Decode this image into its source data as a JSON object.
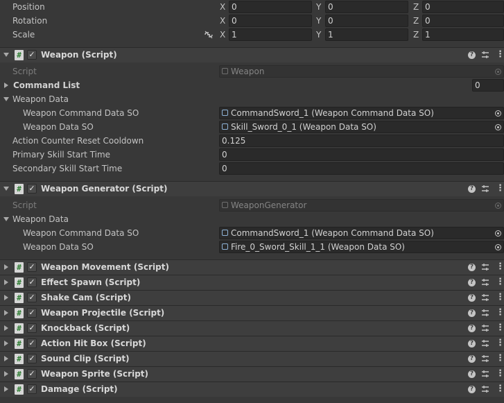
{
  "transform": {
    "position": {
      "label": "Position",
      "x": "0",
      "y": "0",
      "z": "0"
    },
    "rotation": {
      "label": "Rotation",
      "x": "0",
      "y": "0",
      "z": "0"
    },
    "scale": {
      "label": "Scale",
      "x": "1",
      "y": "1",
      "z": "1"
    },
    "axis_x": "X",
    "axis_y": "Y",
    "axis_z": "Z"
  },
  "weapon": {
    "title": "Weapon (Script)",
    "script_label": "Script",
    "script_value": "Weapon",
    "command_list_label": "Command List",
    "command_list_count": "0",
    "weapon_data_label": "Weapon Data",
    "command_data_label": "Weapon Command Data SO",
    "command_data_value": "CommandSword_1 (Weapon Command Data SO)",
    "data_so_label": "Weapon Data SO",
    "data_so_value": "Skill_Sword_0_1 (Weapon Data SO)",
    "cooldown_label": "Action Counter Reset Cooldown",
    "cooldown_value": "0.125",
    "primary_label": "Primary Skill Start Time",
    "primary_value": "0",
    "secondary_label": "Secondary Skill Start Time",
    "secondary_value": "0"
  },
  "generator": {
    "title": "Weapon Generator (Script)",
    "script_label": "Script",
    "script_value": "WeaponGenerator",
    "weapon_data_label": "Weapon Data",
    "command_data_label": "Weapon Command Data SO",
    "command_data_value": "CommandSword_1 (Weapon Command Data SO)",
    "data_so_label": "Weapon Data SO",
    "data_so_value": "Fire_0_Sword_Skill_1_1 (Weapon Data SO)"
  },
  "components": [
    {
      "title": "Weapon Movement (Script)"
    },
    {
      "title": "Effect Spawn (Script)"
    },
    {
      "title": "Shake Cam (Script)"
    },
    {
      "title": "Weapon Projectile (Script)"
    },
    {
      "title": "Knockback (Script)"
    },
    {
      "title": "Action Hit Box (Script)"
    },
    {
      "title": "Sound Clip (Script)"
    },
    {
      "title": "Weapon Sprite (Script)"
    },
    {
      "title": "Damage (Script)"
    }
  ],
  "icons": {
    "script": "#",
    "check": "✓",
    "help": "?",
    "menu": "⋮"
  }
}
